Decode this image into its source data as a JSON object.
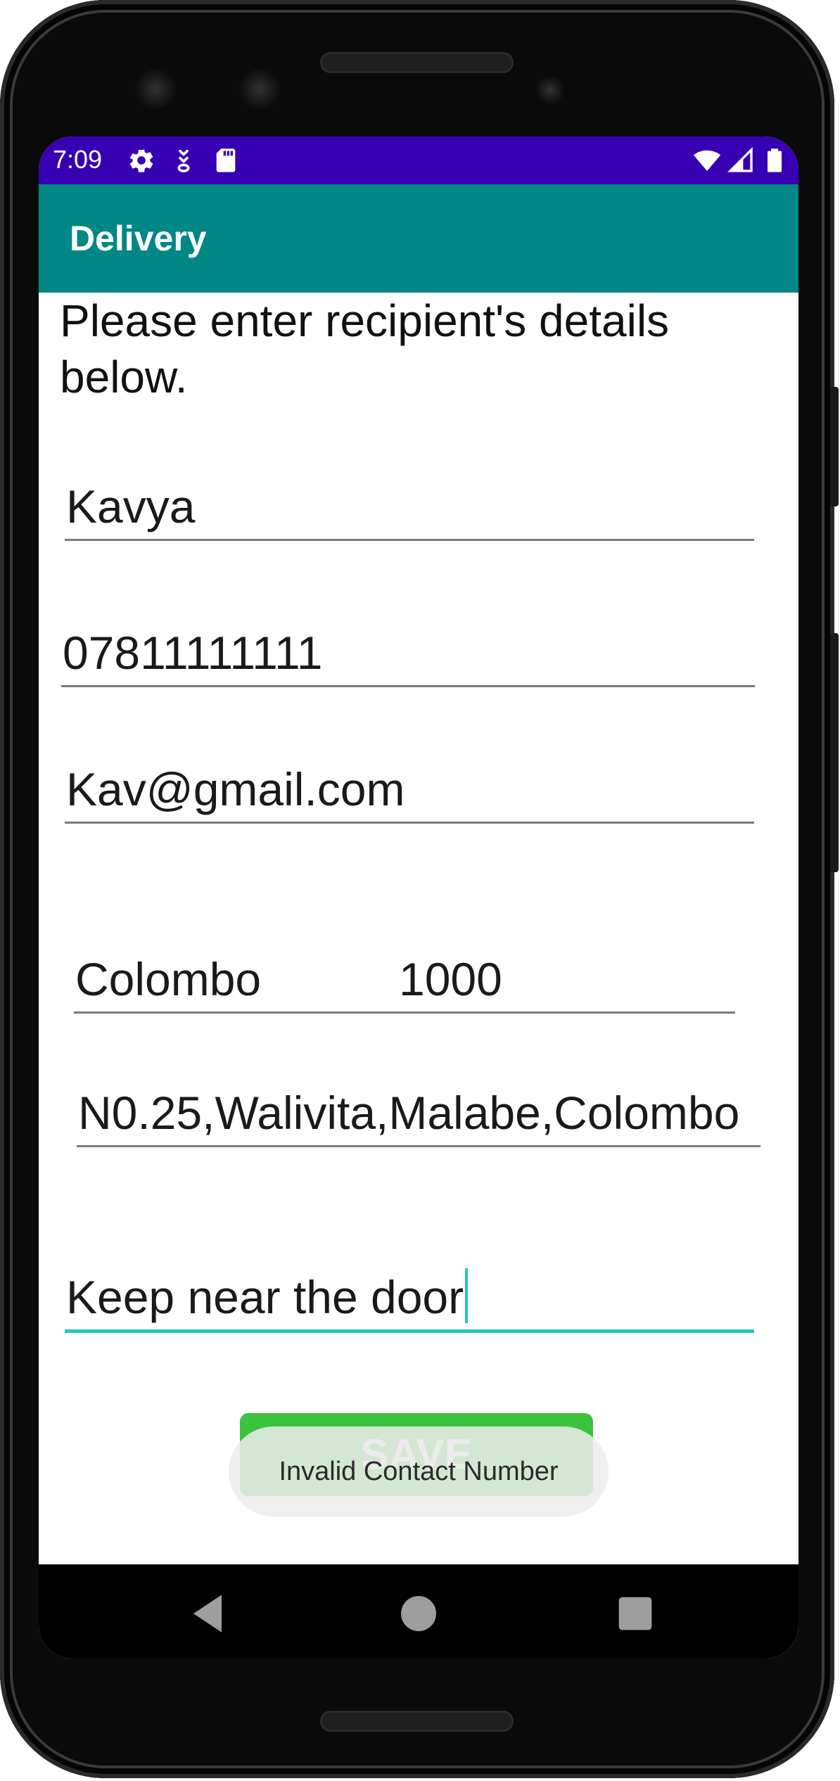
{
  "status_bar": {
    "time": "7:09",
    "background": "#3700b3",
    "left_icons": [
      "gear-icon",
      "download-icon",
      "sd-card-icon"
    ],
    "right_icons": [
      "wifi-icon",
      "signal-icon",
      "battery-icon"
    ]
  },
  "app_bar": {
    "title": "Delivery",
    "background": "#018786"
  },
  "form": {
    "instructions": "Please enter recipient's details below.",
    "name_value": "Kavya",
    "contact_value": "07811111111",
    "email_value": "Kav@gmail.com",
    "city_value": "Colombo",
    "postal_value": "1000",
    "address_value": "N0.25,Walivita,Malabe,Colombo",
    "notes_value": "Keep near the door",
    "focus_color": "#1fc8c4"
  },
  "save_button": {
    "label": "SAVE",
    "color": "#3bc23f"
  },
  "toast": {
    "message": "Invalid Contact Number"
  },
  "nav_bar": {
    "icons": [
      "back-icon",
      "home-icon",
      "recents-icon"
    ]
  }
}
